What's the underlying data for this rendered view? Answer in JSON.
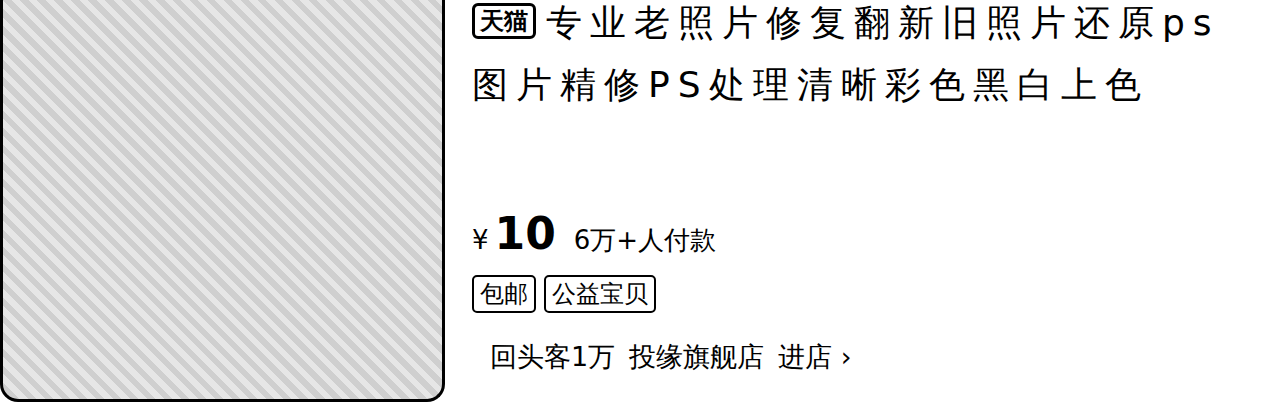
{
  "listing": {
    "badge": "天猫",
    "title": "专业老照片修复翻新旧照片还原ps图片精修PS处理清晰彩色黑白上色",
    "price": {
      "currency": "¥",
      "amount": "10"
    },
    "sales": "6万+人付款",
    "tags": [
      "包邮",
      "公益宝贝"
    ],
    "shop": {
      "repeat": "回头客1万",
      "name": "投缘旗舰店",
      "enter": "进店",
      "arrow": "›"
    }
  }
}
